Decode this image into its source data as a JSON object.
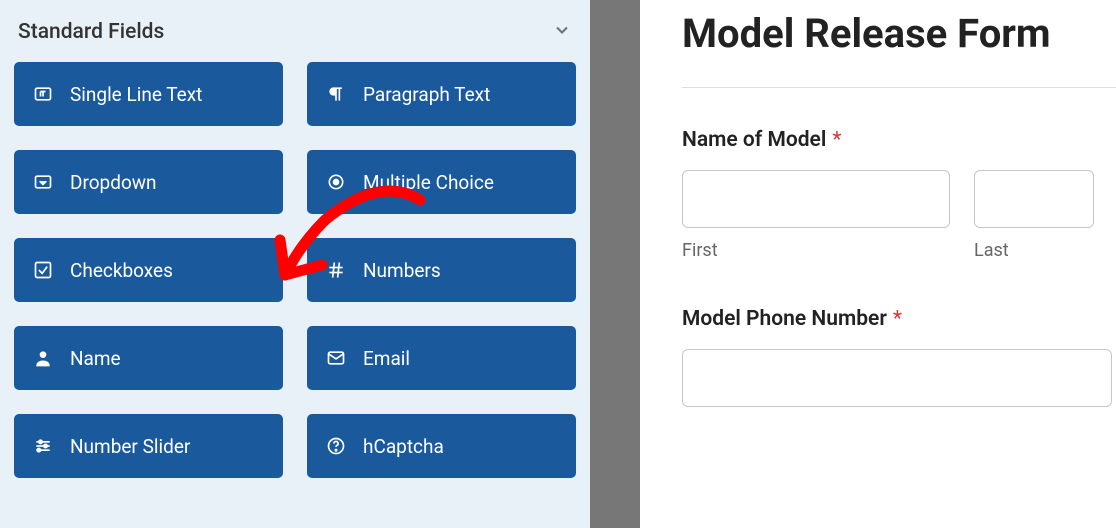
{
  "sidebar": {
    "title": "Standard Fields",
    "fields": [
      {
        "label": "Single Line Text",
        "icon": "text-icon"
      },
      {
        "label": "Paragraph Text",
        "icon": "paragraph-icon"
      },
      {
        "label": "Dropdown",
        "icon": "dropdown-icon"
      },
      {
        "label": "Multiple Choice",
        "icon": "radio-icon"
      },
      {
        "label": "Checkboxes",
        "icon": "checkbox-icon"
      },
      {
        "label": "Numbers",
        "icon": "hash-icon"
      },
      {
        "label": "Name",
        "icon": "person-icon"
      },
      {
        "label": "Email",
        "icon": "envelope-icon"
      },
      {
        "label": "Number Slider",
        "icon": "slider-icon"
      },
      {
        "label": "hCaptcha",
        "icon": "question-icon"
      }
    ]
  },
  "preview": {
    "form_title": "Model Release Form",
    "name_field": {
      "label": "Name of Model",
      "first_sublabel": "First",
      "last_sublabel": "Last"
    },
    "phone_field": {
      "label": "Model Phone Number"
    }
  }
}
